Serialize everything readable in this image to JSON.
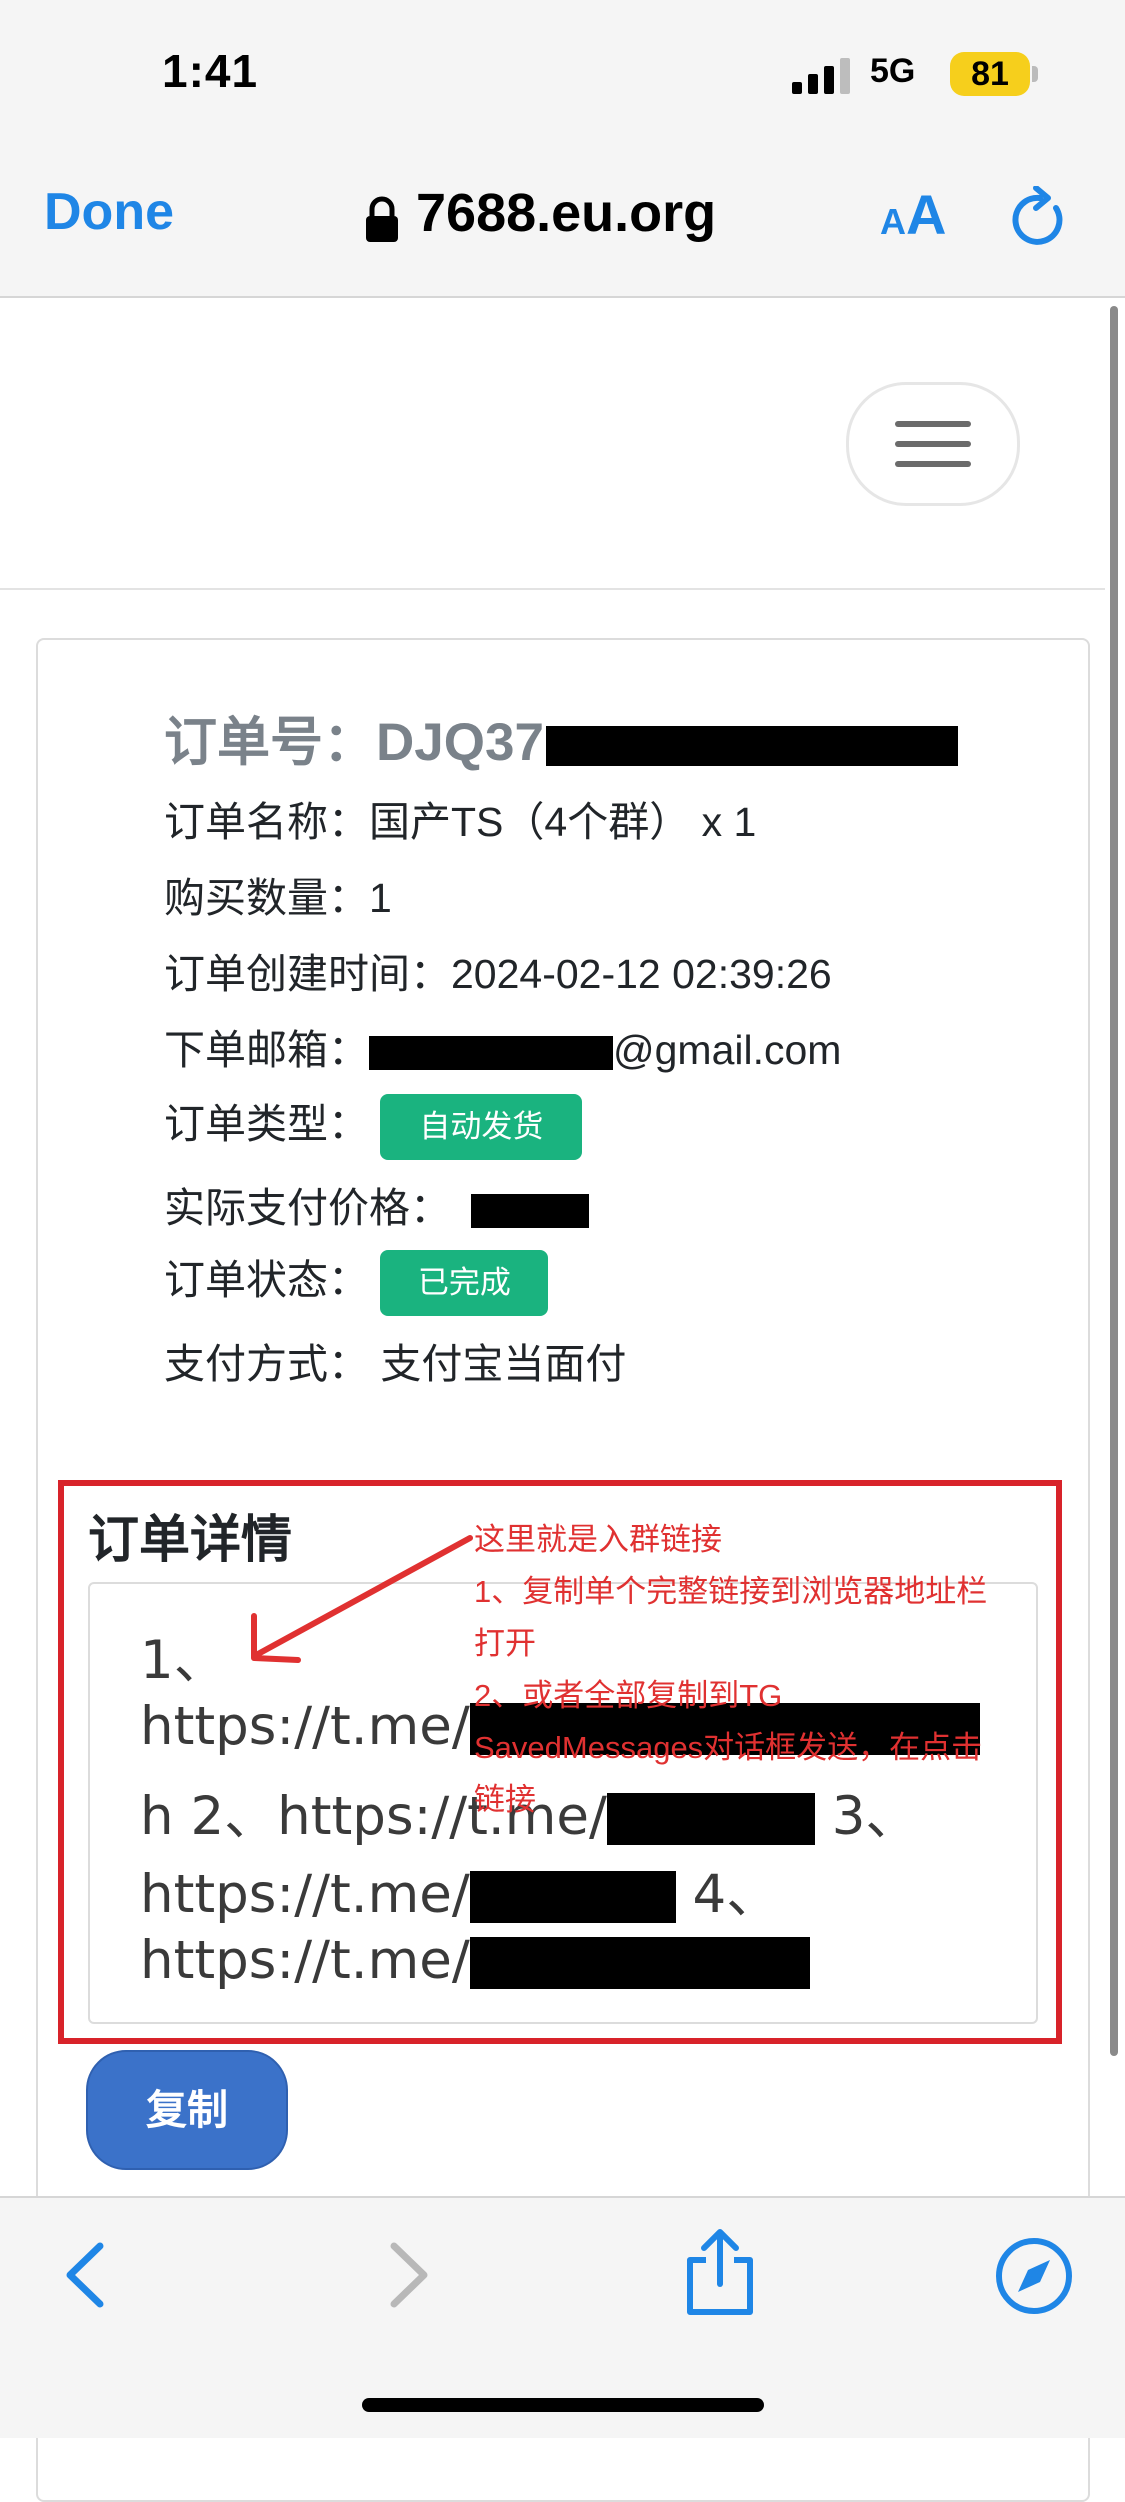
{
  "status_bar": {
    "time": "1:41",
    "network": "5G",
    "battery": "81"
  },
  "browser": {
    "done_label": "Done",
    "url": "7688.eu.org",
    "aa_small": "A",
    "aa_big": "A"
  },
  "order": {
    "number_label": "订单号：",
    "number_visible": "DJQ37",
    "name_label": "订单名称：",
    "name_value": "国产TS（4个群） x 1",
    "quantity_label": "购买数量：",
    "quantity_value": "1",
    "created_label": "订单创建时间：",
    "created_value": "2024-02-12 02:39:26",
    "email_label": "下单邮箱：",
    "email_suffix": "@gmail.com",
    "type_label": "订单类型：",
    "type_badge": "自动发货",
    "price_label": "实际支付价格：",
    "status_label": "订单状态：",
    "status_badge": "已完成",
    "pay_label": "支付方式：",
    "pay_value": "支付宝当面付"
  },
  "details": {
    "title": "订单详情",
    "line1": "1、",
    "line2": "https://t.me/",
    "line3_a": "h 2、https://t.me/",
    "line3_b": " 3、",
    "line4_a": "https://t.me/",
    "line4_b": " 4、",
    "line5": "https://t.me/"
  },
  "annotation": {
    "l1": "这里就是入群链接",
    "l2": "1、复制单个完整链接到浏览器地址栏",
    "l3": "打开",
    "l4": "2、或者全部复制到TG",
    "l5": "SavedMessages对话框发送，在点击",
    "l6": "链接"
  },
  "copy_button": "复制",
  "colors": {
    "accent": "#1f86e6",
    "badge": "#1ab37f",
    "highlight": "#d8232a",
    "button": "#3b72c9"
  }
}
